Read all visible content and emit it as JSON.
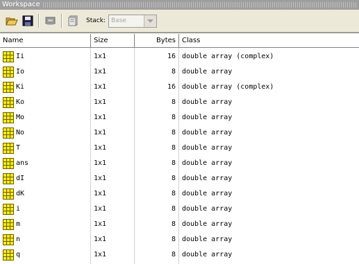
{
  "window": {
    "title": "Workspace"
  },
  "toolbar": {
    "buttons": [
      {
        "icon": "open-folder-icon"
      },
      {
        "icon": "save-disk-icon"
      },
      {
        "icon": "print-icon"
      },
      {
        "icon": "clear-workspace-icon"
      }
    ],
    "stack_label": "Stack:",
    "stack_value": "Base"
  },
  "table": {
    "columns": [
      "Name",
      "Size",
      "Bytes",
      "Class"
    ],
    "rows": [
      {
        "name": "Ii",
        "size": "1x1",
        "bytes": "16",
        "class": "double array (complex)"
      },
      {
        "name": "Io",
        "size": "1x1",
        "bytes": "8",
        "class": "double array"
      },
      {
        "name": "Ki",
        "size": "1x1",
        "bytes": "16",
        "class": "double array (complex)"
      },
      {
        "name": "Ko",
        "size": "1x1",
        "bytes": "8",
        "class": "double array"
      },
      {
        "name": "Mo",
        "size": "1x1",
        "bytes": "8",
        "class": "double array"
      },
      {
        "name": "No",
        "size": "1x1",
        "bytes": "8",
        "class": "double array"
      },
      {
        "name": "T",
        "size": "1x1",
        "bytes": "8",
        "class": "double array"
      },
      {
        "name": "ans",
        "size": "1x1",
        "bytes": "8",
        "class": "double array"
      },
      {
        "name": "dI",
        "size": "1x1",
        "bytes": "8",
        "class": "double array"
      },
      {
        "name": "dK",
        "size": "1x1",
        "bytes": "8",
        "class": "double array"
      },
      {
        "name": "i",
        "size": "1x1",
        "bytes": "8",
        "class": "double array"
      },
      {
        "name": "m",
        "size": "1x1",
        "bytes": "8",
        "class": "double array"
      },
      {
        "name": "n",
        "size": "1x1",
        "bytes": "8",
        "class": "double array"
      },
      {
        "name": "q",
        "size": "1x1",
        "bytes": "8",
        "class": "double array"
      }
    ],
    "row_icon": "array-grid-icon"
  },
  "colors": {
    "titlebar": "#9e9e9e",
    "toolbar": "#ece9d8",
    "icon_fill": "#f7f000",
    "icon_grid": "#6b5a00"
  }
}
